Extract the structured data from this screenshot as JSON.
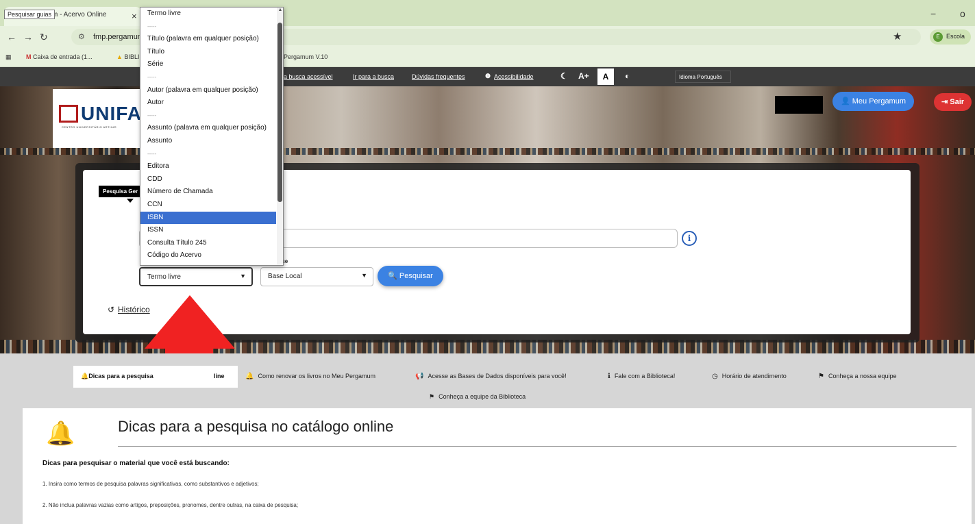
{
  "browser": {
    "tab_title": "m - Acervo Online",
    "tab_close": "×",
    "tooltip": "Pesquisar guias",
    "minimize": "−",
    "maximize": "o",
    "url": "fmp.pergamum.c",
    "profile_label": "Escola",
    "profile_initial": "E",
    "bookmarks": [
      "Caixa de entrada (1...",
      "BIBLI",
      "Pergamum V.10"
    ]
  },
  "site_nav": {
    "links": [
      "a busca acessível",
      "Ir para a busca",
      "Dúvidas frequentes",
      "Acessibilidade"
    ],
    "font_plus": "A+",
    "font_normal": "A",
    "idioma": "Idioma Português"
  },
  "header": {
    "logo_text": "UNIFA",
    "logo_sub": "CENTRO UNIVERSITÁRIO ARTHUR",
    "meu_pergamum": "Meu Pergamum",
    "sair": "Sair"
  },
  "search": {
    "tipo_tab": "Pesquisa Ger",
    "base_label": "base",
    "campo_selected": "Termo livre",
    "base_selected": "Base Local",
    "pesquisar": "Pesquisar",
    "historico": "Histórico",
    "info": "i"
  },
  "dropdown": {
    "options": [
      "Termo livre",
      "-----",
      "Título (palavra em qualquer posição)",
      "Título",
      "Série",
      "-----",
      "Autor (palavra em qualquer posição)",
      "Autor",
      "-----",
      "Assunto (palavra em qualquer posição)",
      "Assunto",
      "-----",
      "Editora",
      "CDD",
      "Número de Chamada",
      "CCN",
      "ISBN",
      "ISSN",
      "Consulta Título 245",
      "Código do Acervo"
    ],
    "highlighted": "ISBN"
  },
  "info_tabs": {
    "active_label": "Dicas para a pesquisa",
    "active_tail": "line",
    "tabs": [
      "Como renovar os livros no Meu Pergamum",
      "Acesse as Bases de Dados disponíveis para você!",
      "Fale com a Biblioteca!",
      "Horário de atendimento",
      "Conheça a nossa equipe"
    ],
    "row2": "Conheça a equipe da Biblioteca"
  },
  "content": {
    "title": "Dicas para a pesquisa no catálogo online",
    "subtitle": "Dicas para pesquisar o material que você está buscando:",
    "items": [
      "1. Insira como termos de pesquisa palavras significativas, como substantivos e adjetivos;",
      "2. Não inclua palavras vazias como artigos, preposições, pronomes, dentre outras, na caixa de pesquisa;"
    ]
  },
  "colors": {
    "accent": "#3b82e3",
    "danger": "#dd3333",
    "highlight": "#3a6fd0",
    "annotation_arrow": "#f02222"
  }
}
